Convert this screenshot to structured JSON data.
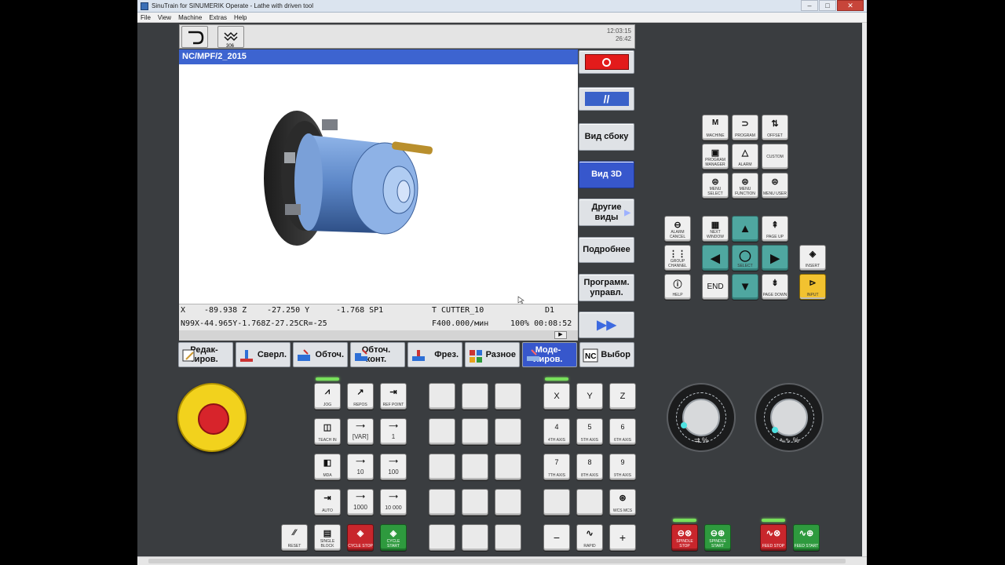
{
  "window": {
    "title": "SinuTrain for SINUMERIK Operate - Lathe with driven tool",
    "menu": [
      "File",
      "View",
      "Machine",
      "Extras",
      "Help"
    ]
  },
  "hmi": {
    "time": "12:03:15",
    "date": "26:42",
    "program_path": "NC/MPF/2_2015",
    "status": {
      "x_label": "X",
      "x_val": "-89.938 Z",
      "z_val": "-27.250 Y",
      "y_val": "-1.768 SP1",
      "tool": "T CUTTER_10",
      "d": "D1",
      "block": "N99X-44.965Y-1.768Z-27.25CR=-25",
      "feed": "F400.000/мин",
      "progress": "100% 00:08:52"
    },
    "vertical_softkeys": [
      "Вид сбоку",
      "Вид 3D",
      "Другие виды",
      "Подробнее",
      "Программ. управл."
    ],
    "horizontal_softkeys": [
      "Редак- тиров.",
      "Сверл.",
      "Обточ.",
      "Обточ. конт.",
      "Фрез.",
      "Разное",
      "Моде- лиров.",
      "Выбор"
    ]
  },
  "keys": {
    "top_right": [
      "MACHINE",
      "PROGRAM",
      "OFFSET",
      "PROGRAM MANAGER",
      "ALARM",
      "CUSTOM",
      "MENU SELECT",
      "MENU FUNCTION",
      "MENU USER"
    ],
    "nav": {
      "alarm_cancel": "ALARM CANCEL",
      "next_window": "NEXT WINDOW",
      "page_up": "PAGE UP",
      "group_channel": "GROUP CHANNEL",
      "select": "SELECT",
      "help": "HELP",
      "end": "END",
      "page_down": "PAGE DOWN",
      "insert": "INSERT",
      "input": "INPUT"
    },
    "jog": {
      "jog": "JOG",
      "repos": "REPOS",
      "ref_point": "REF POINT",
      "teach_in": "TEACH IN",
      "var": "[VAR]",
      "one": "1",
      "mda": "MDA",
      "ten": "10",
      "hundred": "100",
      "auto": "AUTO",
      "thousand": "1000",
      "tenthousand": "10 000",
      "reset": "RESET",
      "single_block": "SINGLE BLOCK",
      "cycle_stop": "CYCLE STOP",
      "cycle_start": "CYCLE START"
    },
    "axes": {
      "x": "X",
      "y": "Y",
      "z": "Z",
      "ax4": "4",
      "ax4s": "4TH AXIS",
      "ax5": "5",
      "ax5s": "5TH AXIS",
      "ax6": "6",
      "ax6s": "6TH AXIS",
      "ax7": "7",
      "ax7s": "7TH AXIS",
      "ax8": "8",
      "ax8s": "8TH AXIS",
      "ax9": "9",
      "ax9s": "9TH AXIS",
      "wcs": "WCS MCS",
      "minus": "−",
      "plus": "+",
      "rapid": "RAPID"
    },
    "spindle": {
      "sp_stop": "SPINDLE STOP",
      "sp_start": "SPINDLE START",
      "feed_stop": "FEED STOP",
      "feed_start": "FEED START"
    }
  },
  "dials": {
    "left_label": "%",
    "right_label": "%"
  },
  "colors": {
    "accent_blue": "#3757cc",
    "led_green": "#78e05b",
    "panel_bg": "#3a3d40",
    "teal": "#4fa7a0",
    "input_yellow": "#f2c230"
  }
}
